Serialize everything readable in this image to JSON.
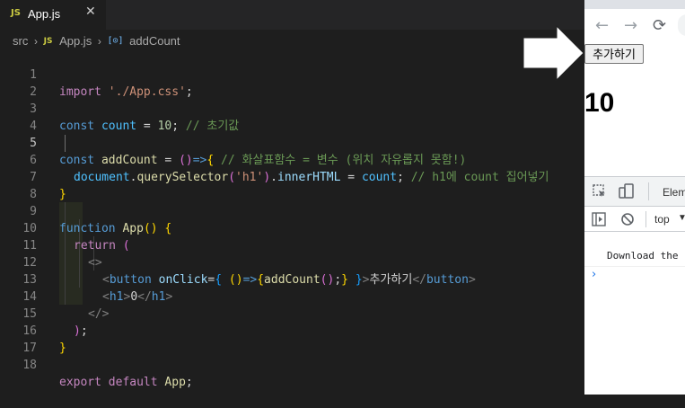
{
  "editor": {
    "tab": {
      "js_badge": "JS",
      "filename": "App.js",
      "close": "✕"
    },
    "breadcrumb": {
      "folder": "src",
      "js_badge": "JS",
      "file": "App.js",
      "symbol_icon": "[⊙]",
      "symbol": "addCount"
    }
  },
  "code": {
    "line_numbers": [
      "1",
      "2",
      "3",
      "4",
      "5",
      "6",
      "7",
      "8",
      "9",
      "10",
      "11",
      "12",
      "13",
      "14",
      "15",
      "16",
      "17",
      "18"
    ],
    "l1": {
      "kw": "import",
      "str": "'./App.css'",
      "punc": ";"
    },
    "l3": {
      "kw": "const",
      "var": "count",
      "eq": " = ",
      "num": "10",
      "punc": ";",
      "cmt": "// 초기값"
    },
    "l5": {
      "kw": "const",
      "fn": "addCount",
      "eq": " = ",
      "paren": "()",
      "arrow": "=>",
      "brace": "{",
      "cmt": "// 화살표함수 = 변수 (위치 자유롭지 못함!)"
    },
    "l6": {
      "obj": "document",
      "dot1": ".",
      "method": "querySelector",
      "p1": "(",
      "str": "'h1'",
      "p2": ")",
      "dot2": ".",
      "prop": "innerHTML",
      "eq": " = ",
      "var": "count",
      "punc": ";",
      "cmt": "// h1에 count 집어넣기"
    },
    "l7": {
      "brace": "}"
    },
    "l9": {
      "kw": "function",
      "fn": "App",
      "paren": "()",
      "brace": "{"
    },
    "l10": {
      "kw": "return",
      "paren": "("
    },
    "l11": {
      "tag": "<>"
    },
    "l12": {
      "lt": "<",
      "tag": "button",
      "attr": "onClick",
      "eq": "=",
      "b_open": "{",
      "paren": "()",
      "arrow": "=>",
      "b2": "{",
      "fn": "addCount",
      "call": "()",
      "semi": ";",
      "b2c": "}",
      "b_close": "}",
      "gt": ">",
      "text": "추가하기",
      "close_lt": "</",
      "close_tag": "button",
      "close_gt": ">"
    },
    "l13": {
      "lt": "<",
      "tag": "h1",
      "gt": ">",
      "text": "0",
      "close_lt": "</",
      "close_tag": "h1",
      "close_gt": ">"
    },
    "l14": {
      "tag": "</>"
    },
    "l15": {
      "paren": ")",
      "punc": ";"
    },
    "l16": {
      "brace": "}"
    },
    "l18": {
      "kw1": "export",
      "kw2": "default",
      "name": "App",
      "punc": ";"
    }
  },
  "browser": {
    "back": "←",
    "forward": "→",
    "reload": "⟳",
    "button_label": "추가하기",
    "heading": "10",
    "devtools": {
      "elements_tab": "Elem",
      "context": "top",
      "context_arrow": "▼",
      "message": "Download the",
      "prompt": "›"
    }
  }
}
